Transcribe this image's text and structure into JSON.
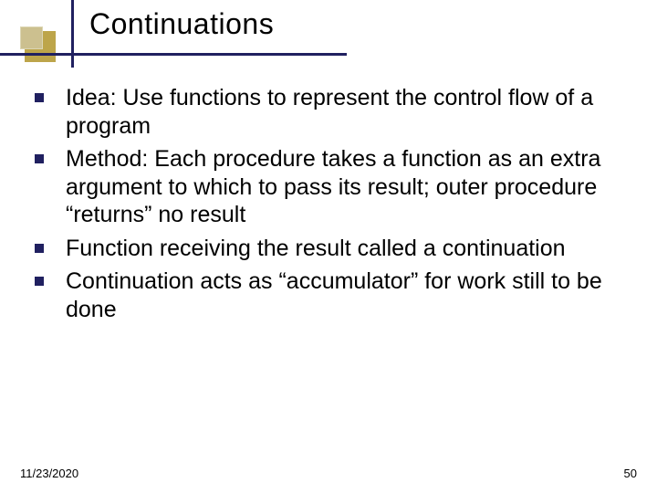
{
  "slide": {
    "title": "Continuations",
    "bullets": [
      "Idea: Use functions to represent the control flow of a program",
      "Method: Each procedure takes a function as an extra argument to which to pass its result; outer procedure “returns” no result",
      "Function receiving the result called a continuation",
      "Continuation acts as “accumulator” for work still to be done"
    ],
    "footer": {
      "date": "11/23/2020",
      "page": "50"
    }
  }
}
